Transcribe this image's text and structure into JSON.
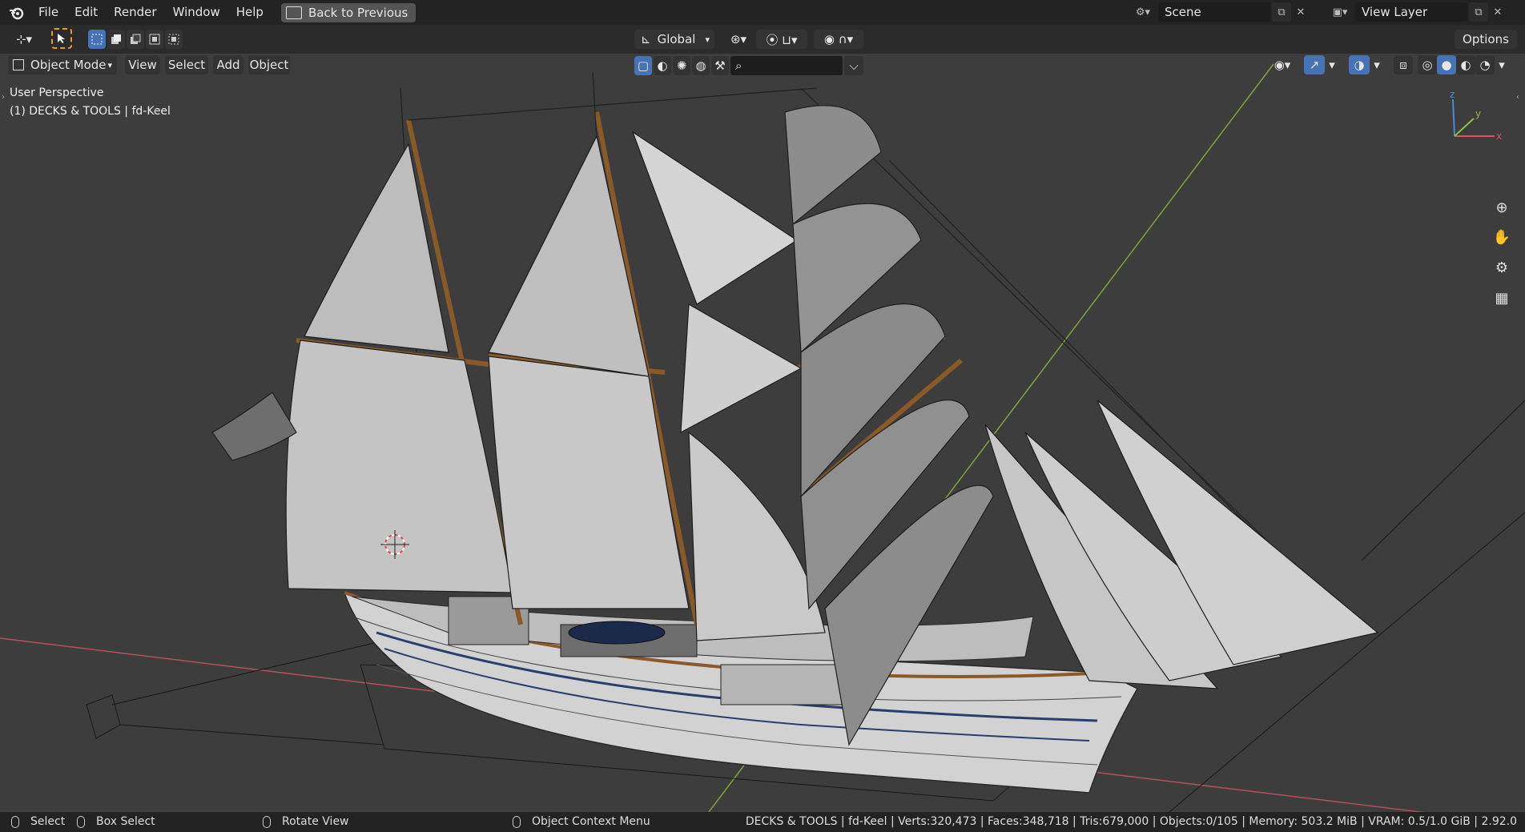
{
  "topbar": {
    "menu": [
      "File",
      "Edit",
      "Render",
      "Window",
      "Help"
    ],
    "back_label": "Back to Previous",
    "scene_name": "Scene",
    "view_layer_name": "View Layer"
  },
  "toolbar": {
    "orientation": "Global",
    "options_label": "Options"
  },
  "header": {
    "mode": "Object Mode",
    "menus": [
      "View",
      "Select",
      "Add",
      "Object"
    ]
  },
  "viewport": {
    "perspective_label": "User Perspective",
    "object_label": "(1) DECKS & TOOLS | fd-Keel",
    "axis_labels": {
      "x": "x",
      "y": "y",
      "z": "z"
    }
  },
  "statusbar": {
    "select": "Select",
    "box_select": "Box Select",
    "rotate": "Rotate View",
    "context_menu": "Object Context Menu",
    "stats": "DECKS & TOOLS | fd-Keel | Verts:320,473 | Faces:348,718 | Tris:679,000 | Objects:0/105 | Memory: 503.2 MiB | VRAM: 0.5/1.0 GiB | 2.92.0"
  },
  "colors": {
    "accent": "#4772b3",
    "x_axis": "#d9545f",
    "y_axis": "#8cbf4a",
    "z_axis": "#4a8ad9"
  }
}
